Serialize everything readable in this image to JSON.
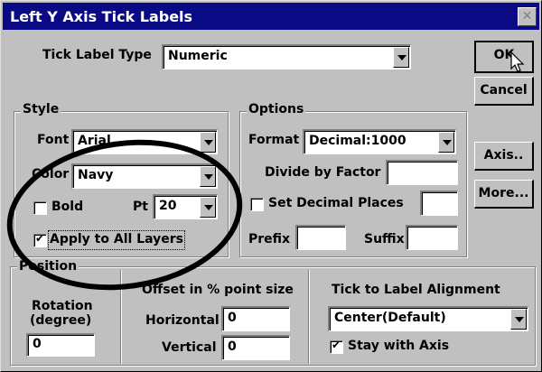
{
  "title": "Left Y Axis Tick Labels",
  "close_icon": "close-icon",
  "tick_label_type": {
    "label": "Tick Label Type",
    "value": "Numeric"
  },
  "buttons": {
    "ok": "OK",
    "cancel": "Cancel",
    "axis": "Axis..",
    "more": "More..."
  },
  "style": {
    "title": "Style",
    "font_label": "Font",
    "font_value": "Arial",
    "color_label": "Color",
    "color_value": "Navy",
    "bold_label": "Bold",
    "bold_checked": false,
    "pt_label": "Pt",
    "pt_value": "20",
    "apply_label": "Apply to All Layers",
    "apply_checked": true
  },
  "options": {
    "title": "Options",
    "format_label": "Format",
    "format_value": "Decimal:1000",
    "divide_label": "Divide by Factor",
    "divide_value": "",
    "set_decimal_label": "Set Decimal Places",
    "set_decimal_checked": false,
    "decimal_value": "",
    "prefix_label": "Prefix",
    "prefix_value": "",
    "suffix_label": "Suffix",
    "suffix_value": ""
  },
  "position": {
    "title": "Position",
    "rotation_label_1": "Rotation",
    "rotation_label_2": "(degree)",
    "rotation_value": "0",
    "offset_label": "Offset in % point size",
    "horizontal_label": "Horizontal",
    "horizontal_value": "0",
    "vertical_label": "Vertical",
    "vertical_value": "0",
    "alignment_label": "Tick to Label Alignment",
    "alignment_value": "Center(Default)",
    "stay_label": "Stay with Axis",
    "stay_checked": true
  },
  "colors": {
    "titlebar": "#0a0a84",
    "dialog": "#c0c0c0"
  }
}
